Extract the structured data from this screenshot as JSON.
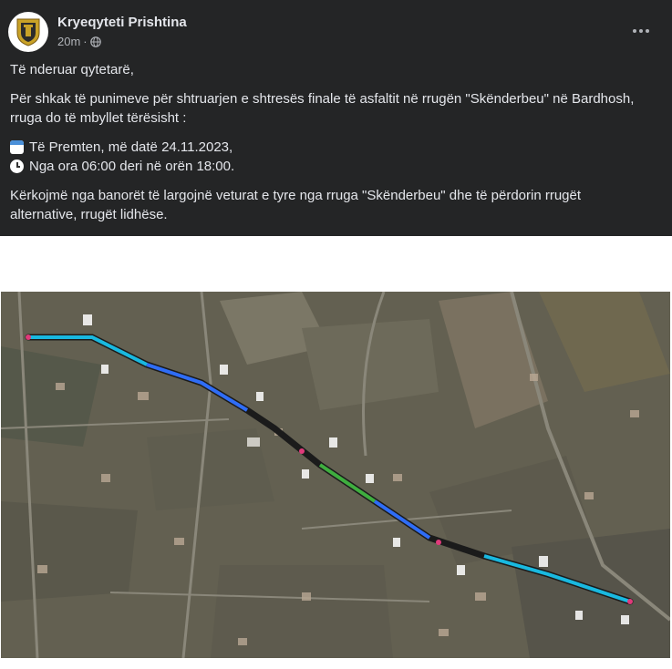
{
  "post": {
    "author": "Kryeqyteti Prishtina",
    "time": "20m",
    "separator": "·",
    "logo_icon": "city-crest-icon",
    "privacy_icon": "globe-icon",
    "more_icon": "more-horizontal-icon",
    "greeting": "Të nderuar qytetarë,",
    "paragraph1": "Për shkak të punimeve për shtruarjen e shtresës finale të asfaltit në rrugën \"Skënderbeu\" në Bardhosh, rruga do të mbyllet tërësisht :",
    "date_icon": "calendar-icon",
    "date_line": "Të Premten, më datë 24.11.2023,",
    "time_icon": "clock-icon",
    "time_line": "Nga ora 06:00 deri në orën 18:00.",
    "paragraph2": "Kërkojmë nga banorët të largojnë veturat e tyre nga rruga \"Skënderbeu\" dhe të përdorin rrugët alternative, rrugët lidhëse."
  },
  "image": {
    "subject": "satellite-map-road-closure",
    "route_colors": [
      "#2f6df6",
      "#19b9e0",
      "#1b1b1b",
      "#3fae3f",
      "#e03a7a"
    ]
  }
}
